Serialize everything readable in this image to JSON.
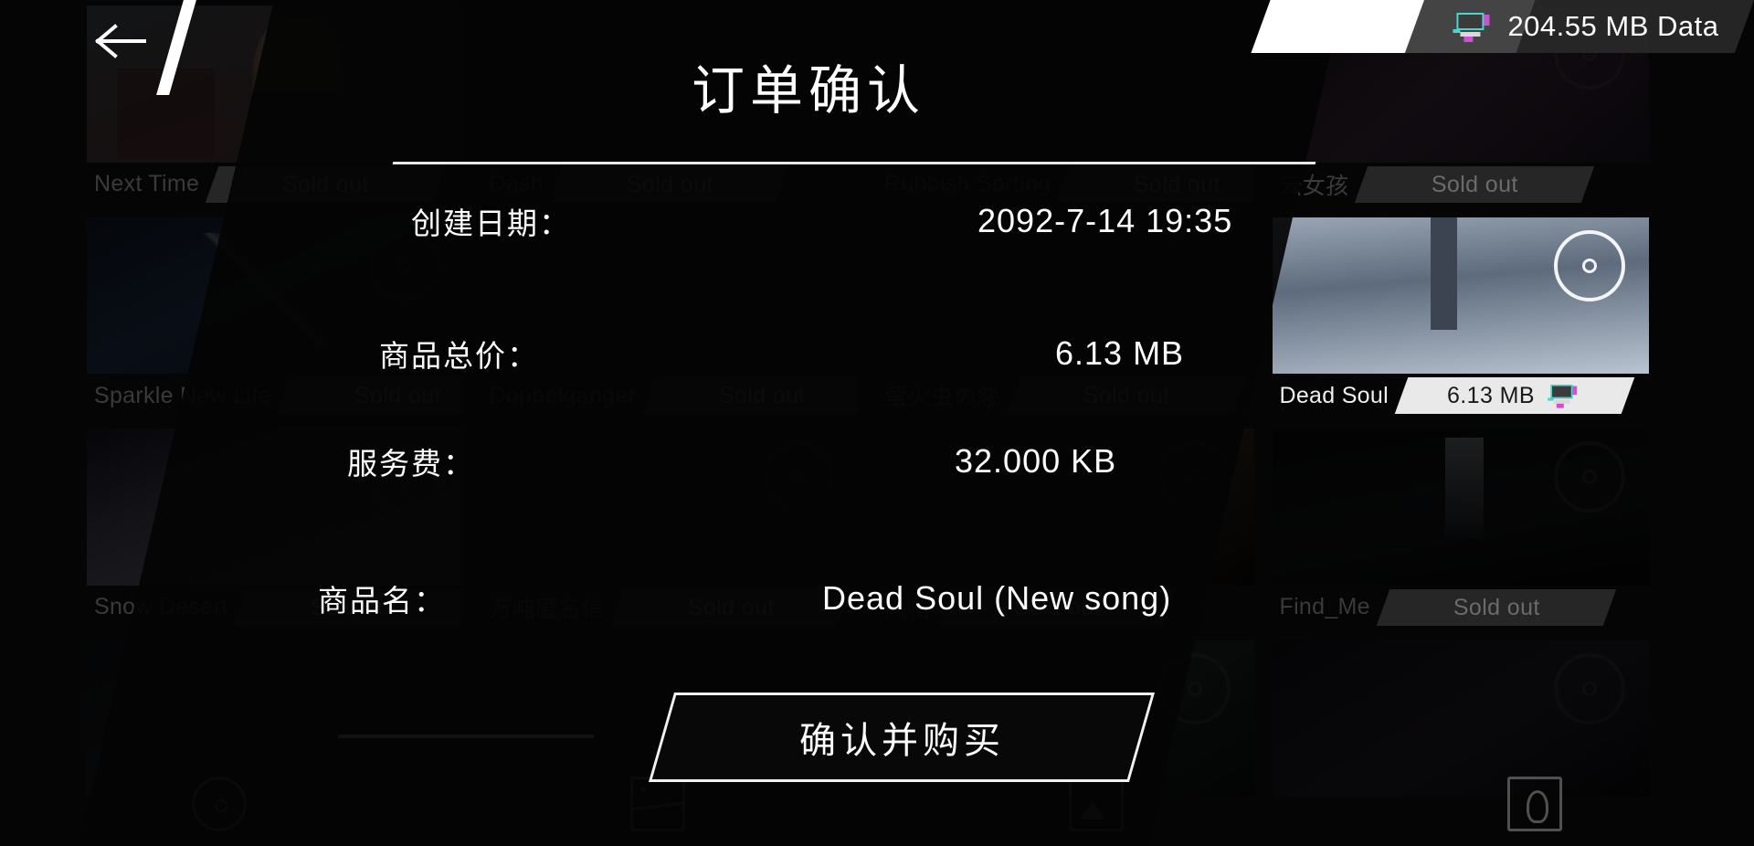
{
  "header": {
    "back_icon": "back-arrow-icon",
    "data_badge": {
      "icon": "pixel-computer-icon",
      "label": "204.55 MB Data"
    }
  },
  "dialog": {
    "title": "订单确认",
    "rows": [
      {
        "label": "创建日期：",
        "value": "2092-7-14 19:35",
        "name": "creation-date"
      },
      {
        "label": "商品总价：",
        "value": "6.13 MB",
        "name": "total-price"
      },
      {
        "label": "服务费：",
        "value": "32.000 KB",
        "name": "service-fee"
      },
      {
        "label": "商品名：",
        "value": "Dead Soul (New song)",
        "name": "product-name"
      }
    ],
    "confirm_button": "确认并购买"
  },
  "store": {
    "cards": [
      {
        "title": "Next Time",
        "badge": "Sold out",
        "state": "dim",
        "art": "art-nexttime"
      },
      {
        "title": "Dash",
        "badge": "Sold out",
        "state": "dim",
        "art": "art-dash"
      },
      {
        "title": "Rubbish Sorting",
        "badge": "Sold out",
        "state": "dim",
        "art": "art-rubbish"
      },
      {
        "title": "云女孩",
        "badge": "Sold out",
        "state": "dim",
        "art": "art-yunnv"
      },
      {
        "title": "Sparkle New Life",
        "badge": "Sold out",
        "state": "dim",
        "art": "art-sparkle"
      },
      {
        "title": "Doppelganger",
        "badge": "Sold out",
        "state": "dim",
        "art": "art-doppel"
      },
      {
        "title": "萤火虫の怨",
        "badge": "Sold out",
        "state": "dim",
        "art": "art-hotaru"
      },
      {
        "title": "Dead Soul",
        "badge": "6.13 MB",
        "state": "bright",
        "art": "art-deadsoul",
        "badge_icon": "pixel-computer-icon"
      },
      {
        "title": "Snow Desert",
        "badge": "Sold out",
        "state": "dim",
        "art": "art-snow"
      },
      {
        "title": "万吨匿名信",
        "badge": "Sold out",
        "state": "dim",
        "art": "art-wandun"
      },
      {
        "title": "风帖",
        "badge": "Sold out",
        "state": "dim",
        "art": "art-fengzhi"
      },
      {
        "title": "Find_Me",
        "badge": "Sold out",
        "state": "dim",
        "art": "art-findme"
      },
      {
        "title": "",
        "badge": "",
        "state": "dim",
        "art": "art-row4a"
      },
      {
        "title": "",
        "badge": "",
        "state": "dim",
        "art": "art-row4b"
      },
      {
        "title": "",
        "badge": "",
        "state": "dim",
        "art": "art-row4c"
      },
      {
        "title": "",
        "badge": "",
        "state": "dim",
        "art": "art-row4d"
      }
    ]
  },
  "bottom_nav": {
    "items": [
      {
        "icon": "disc-circle-icon",
        "name": "nav-disc"
      },
      {
        "icon": "card-icon",
        "name": "nav-card"
      },
      {
        "icon": "mountain-icon",
        "name": "nav-gallery"
      },
      {
        "icon": "person-icon",
        "name": "nav-profile"
      }
    ]
  },
  "colors": {
    "accent_white": "#ffffff",
    "badge_active_bg": "#e9e9e9",
    "badge_dim_bg": "#262626",
    "overlay_bg": "#040404"
  }
}
